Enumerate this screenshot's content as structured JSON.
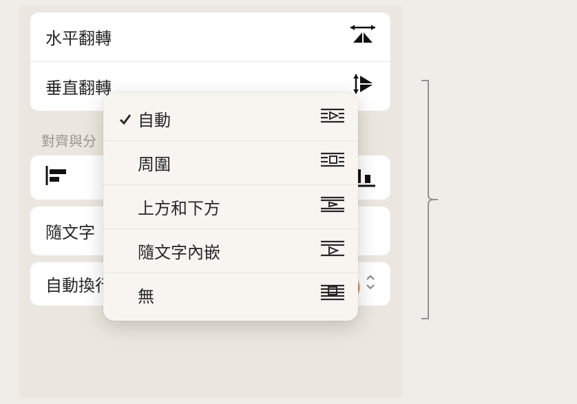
{
  "flip": {
    "horizontal_label": "水平翻轉",
    "vertical_label": "垂直翻轉"
  },
  "align_section_label": "對齊與分",
  "inline_text_label": "隨文字",
  "autowrap_row": {
    "label": "自動換行",
    "value": "自動"
  },
  "popup": {
    "items": [
      {
        "label": "自動",
        "checked": true,
        "icon": "around"
      },
      {
        "label": "周圍",
        "checked": false,
        "icon": "around"
      },
      {
        "label": "上方和下方",
        "checked": false,
        "icon": "above-below"
      },
      {
        "label": "隨文字內嵌",
        "checked": false,
        "icon": "above-below"
      },
      {
        "label": "無",
        "checked": false,
        "icon": "none"
      }
    ]
  }
}
